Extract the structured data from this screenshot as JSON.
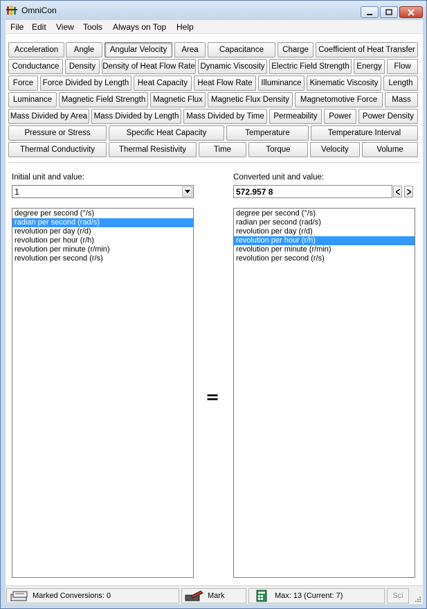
{
  "window": {
    "title": "OmniCon"
  },
  "menu": [
    "File",
    "Edit",
    "View",
    "Tools",
    "Always on Top",
    "Help"
  ],
  "quantity_rows": [
    [
      {
        "label": "Acceleration",
        "active": false
      },
      {
        "label": "Angle",
        "active": false
      },
      {
        "label": "Angular Velocity",
        "active": true
      },
      {
        "label": "Area",
        "active": false
      },
      {
        "label": "Capacitance",
        "active": false
      },
      {
        "label": "Charge",
        "active": false
      },
      {
        "label": "Coefficient of Heat Transfer",
        "active": false
      }
    ],
    [
      {
        "label": "Conductance",
        "active": false
      },
      {
        "label": "Density",
        "active": false
      },
      {
        "label": "Density of Heat Flow Rate",
        "active": false
      },
      {
        "label": "Dynamic Viscosity",
        "active": false
      },
      {
        "label": "Electric Field Strength",
        "active": false
      },
      {
        "label": "Energy",
        "active": false
      },
      {
        "label": "Flow",
        "active": false
      }
    ],
    [
      {
        "label": "Force",
        "active": false
      },
      {
        "label": "Force Divided by Length",
        "active": false
      },
      {
        "label": "Heat Capacity",
        "active": false
      },
      {
        "label": "Heat Flow Rate",
        "active": false
      },
      {
        "label": "Illuminance",
        "active": false
      },
      {
        "label": "Kinematic Viscosity",
        "active": false
      },
      {
        "label": "Length",
        "active": false
      }
    ],
    [
      {
        "label": "Luminance",
        "active": false
      },
      {
        "label": "Magnetic Field Strength",
        "active": false
      },
      {
        "label": "Magnetic Flux",
        "active": false
      },
      {
        "label": "Magnetic Flux Density",
        "active": false
      },
      {
        "label": "Magnetomotive Force",
        "active": false
      },
      {
        "label": "Mass",
        "active": false
      }
    ],
    [
      {
        "label": "Mass Divided by Area",
        "active": false
      },
      {
        "label": "Mass Divided by Length",
        "active": false
      },
      {
        "label": "Mass Divided by Time",
        "active": false
      },
      {
        "label": "Permeability",
        "active": false
      },
      {
        "label": "Power",
        "active": false
      },
      {
        "label": "Power Density",
        "active": false
      }
    ],
    [
      {
        "label": "Pressure or Stress",
        "active": false
      },
      {
        "label": "Specific Heat Capacity",
        "active": false
      },
      {
        "label": "Temperature",
        "active": false
      },
      {
        "label": "Temperature Interval",
        "active": false
      }
    ],
    [
      {
        "label": "Thermal Conductivity",
        "active": false
      },
      {
        "label": "Thermal Resistivity",
        "active": false
      },
      {
        "label": "Time",
        "active": false
      },
      {
        "label": "Torque",
        "active": false
      },
      {
        "label": "Velocity",
        "active": false
      },
      {
        "label": "Volume",
        "active": false
      }
    ]
  ],
  "input": {
    "label": "Initial unit and value:",
    "value": "1",
    "units": [
      "degree per second (°/s)",
      "radian per second (rad/s)",
      "revolution per day (r/d)",
      "revolution per hour (r/h)",
      "revolution per minute (r/min)",
      "revolution per second (r/s)"
    ],
    "selected_index": 1
  },
  "output": {
    "label": "Converted unit and value:",
    "value": "572.957 8",
    "units": [
      "degree per second (°/s)",
      "radian per second (rad/s)",
      "revolution per day (r/d)",
      "revolution per hour (r/h)",
      "revolution per minute (r/min)",
      "revolution per second (r/s)"
    ],
    "selected_index": 3
  },
  "equals_sign": "=",
  "status": {
    "marked_conversions": "Marked Conversions: 0",
    "mark": "Mark",
    "max": "Max: 13 (Current: 7)",
    "sci": "Sci"
  },
  "colors": {
    "selection": "#3399ff",
    "window_frame": "#c9d9ec"
  }
}
